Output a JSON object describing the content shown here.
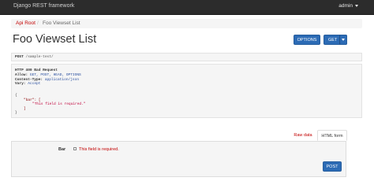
{
  "navbar": {
    "brand": "Django REST framework",
    "user": "admin"
  },
  "breadcrumb": {
    "root": "Api Root",
    "separator": "/",
    "current": "Foo Viewset List"
  },
  "page": {
    "title": "Foo Viewset List"
  },
  "buttons": {
    "options": "OPTIONS",
    "get": "GET",
    "post": "POST"
  },
  "request": {
    "method": "POST",
    "path": "/sample-test/"
  },
  "response": {
    "status": "HTTP 400 Bad Request",
    "headers": [
      {
        "name": "Allow:",
        "value": "GET, POST, HEAD, OPTIONS"
      },
      {
        "name": "Content-Type:",
        "value": "application/json"
      },
      {
        "name": "Vary:",
        "value": "Accept"
      }
    ],
    "body": {
      "open": "{",
      "key": "\"bar\":",
      "list_open": "[",
      "message": "\"This field is required.\"",
      "list_close": "]",
      "close": "}"
    }
  },
  "tabs": {
    "raw": "Raw data",
    "html": "HTML form"
  },
  "form": {
    "field_label": "Bar",
    "field_error": "This field is required."
  },
  "colors": {
    "accent": "#c20000",
    "primary_button": "#2c6bb5",
    "navbar": "#2c2c2c"
  }
}
